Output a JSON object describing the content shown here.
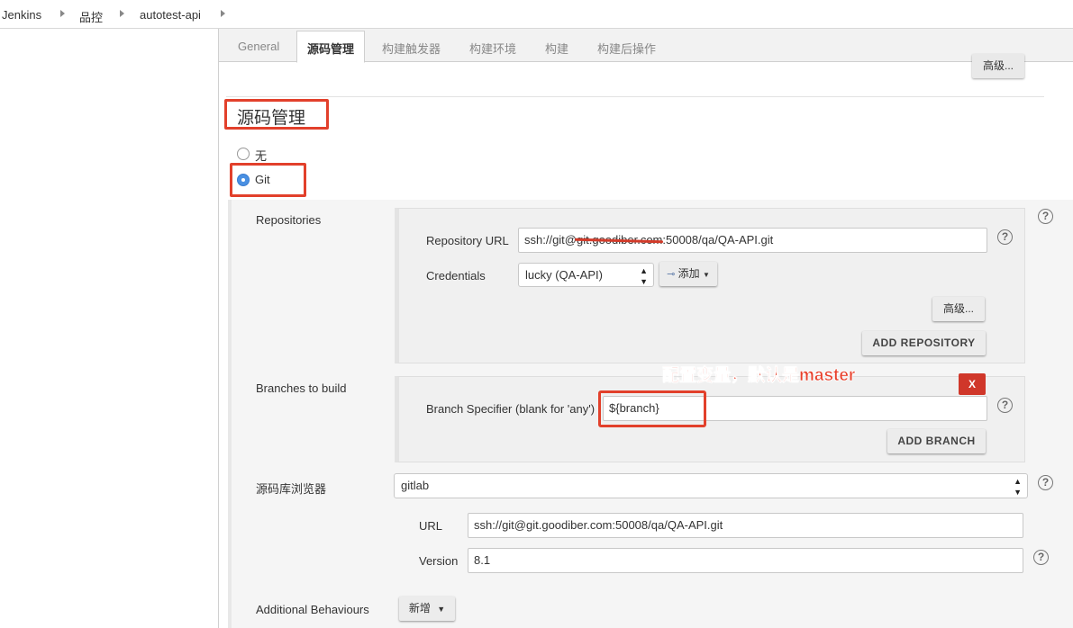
{
  "breadcrumb": [
    "Jenkins",
    "品控",
    "autotest-api"
  ],
  "tabs": [
    "General",
    "源码管理",
    "构建触发器",
    "构建环境",
    "构建",
    "构建后操作"
  ],
  "active_tab": "源码管理",
  "top_advanced_label": "高级...",
  "section_title": "源码管理",
  "scm_options": {
    "none": "无",
    "git": "Git",
    "selected": "Git"
  },
  "repositories": {
    "label": "Repositories",
    "url_label": "Repository URL",
    "url_value": "ssh://git@git.goodiber.com:50008/qa/QA-API.git",
    "credentials_label": "Credentials",
    "credentials_value": "lucky (QA-API)",
    "add_label": "添加",
    "advanced_label": "高级...",
    "add_repository_label": "ADD REPOSITORY"
  },
  "branches": {
    "label": "Branches to build",
    "specifier_label": "Branch Specifier (blank for 'any')",
    "specifier_value": "${branch}",
    "delete_label": "X",
    "add_branch_label": "ADD BRANCH"
  },
  "annotation": "配置变量，默认是master",
  "repo_browser": {
    "label": "源码库浏览器",
    "value": "gitlab",
    "url_label": "URL",
    "url_value": "ssh://git@git.goodiber.com:50008/qa/QA-API.git",
    "version_label": "Version",
    "version_value": "8.1"
  },
  "additional_behaviours": {
    "label": "Additional Behaviours",
    "add_label": "新增"
  },
  "colors": {
    "highlight": "#e2402b",
    "radio_checked": "#4a90e2",
    "delete": "#d0372a"
  }
}
